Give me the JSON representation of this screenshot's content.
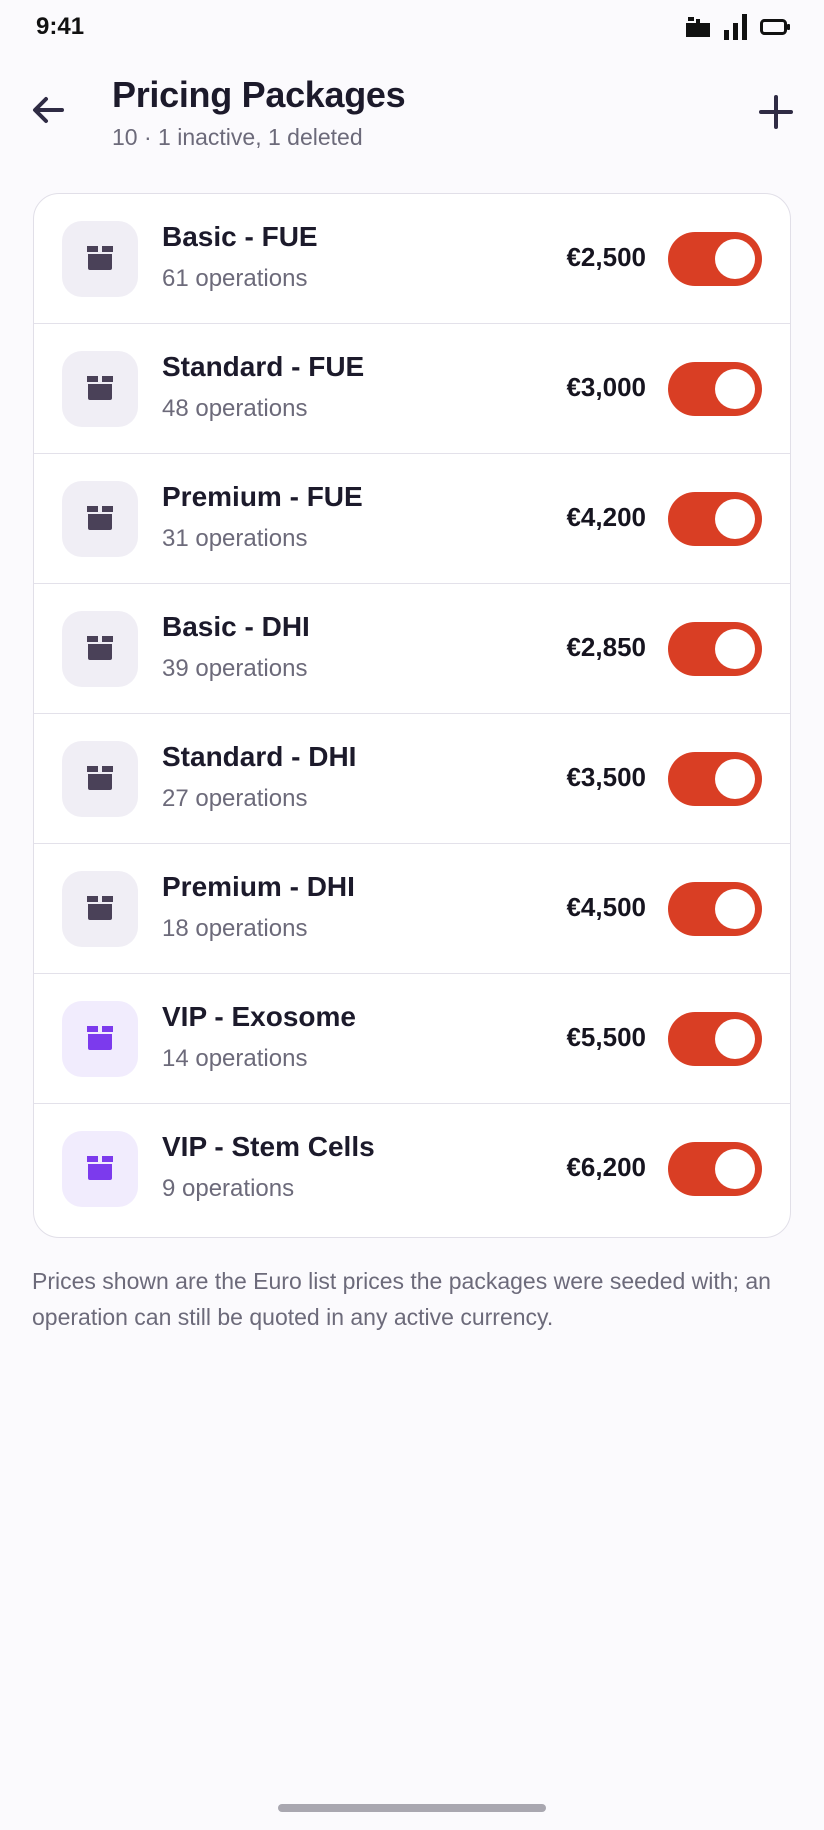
{
  "status_bar": {
    "time": "9:41",
    "icons": [
      "notification-icon",
      "signal-icon",
      "battery-icon"
    ]
  },
  "header": {
    "back_icon": "arrow-left-icon",
    "title": "Pricing Packages",
    "subtitle": "10 · 1 inactive, 1 deleted",
    "add_icon": "plus-icon"
  },
  "packages": [
    {
      "name": "Basic - FUE",
      "operations": "61 operations",
      "price": "€2,500",
      "active": true,
      "icon": "package-icon",
      "tier": "standard"
    },
    {
      "name": "Standard - FUE",
      "operations": "48 operations",
      "price": "€3,000",
      "active": true,
      "icon": "package-icon",
      "tier": "standard"
    },
    {
      "name": "Premium - FUE",
      "operations": "31 operations",
      "price": "€4,200",
      "active": true,
      "icon": "package-icon",
      "tier": "standard"
    },
    {
      "name": "Basic - DHI",
      "operations": "39 operations",
      "price": "€2,850",
      "active": true,
      "icon": "package-icon",
      "tier": "standard"
    },
    {
      "name": "Standard - DHI",
      "operations": "27 operations",
      "price": "€3,500",
      "active": true,
      "icon": "package-icon",
      "tier": "standard"
    },
    {
      "name": "Premium - DHI",
      "operations": "18 operations",
      "price": "€4,500",
      "active": true,
      "icon": "package-icon",
      "tier": "standard"
    },
    {
      "name": "VIP - Exosome",
      "operations": "14 operations",
      "price": "€5,500",
      "active": true,
      "icon": "package-icon",
      "tier": "vip"
    },
    {
      "name": "VIP - Stem Cells",
      "operations": "9 operations",
      "price": "€6,200",
      "active": true,
      "icon": "package-icon",
      "tier": "vip"
    }
  ],
  "footnote": "Prices shown are the Euro list prices the packages were seeded with; an operation can still be quoted in any active currency.",
  "colors": {
    "toggle_on": "#d93e24",
    "package_icon": "#4a4158",
    "vip_icon": "#7c3aed",
    "background": "#fbfafd"
  }
}
